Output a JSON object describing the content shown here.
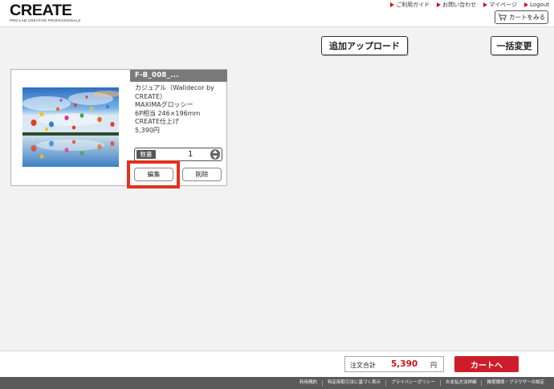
{
  "brand": {
    "logo_text": "CREATE",
    "tagline": "PRO-LAB CREATIVE PROFESSIONALS"
  },
  "top_links": [
    {
      "label": "ご利用ガイド"
    },
    {
      "label": "お問い合わせ"
    },
    {
      "label": "マイページ"
    },
    {
      "label": "Logout"
    }
  ],
  "header": {
    "cart_label": "カートをみる"
  },
  "toolbar": {
    "upload_label": "追加アップロード",
    "bulk_change_label": "一括変更"
  },
  "item": {
    "title": "F-B_008_...",
    "description_lines": [
      "カジュアル（Walldecor by",
      "CREATE）",
      "MAXIMAグロッシー",
      "6P相当 246×196mm",
      "CREATE仕上げ",
      "5,390円"
    ],
    "quantity_label": "数量",
    "quantity": "1",
    "edit_label": "編集",
    "delete_label": "削除"
  },
  "summary": {
    "total_label": "注文合計",
    "total_amount": "5,390",
    "currency": "円",
    "checkout_label": "カートへ"
  },
  "footer_links": [
    {
      "label": "利用規約"
    },
    {
      "label": "特定商取引法に基づく表示"
    },
    {
      "label": "プライバシーポリシー"
    },
    {
      "label": "お支払方法詳細"
    },
    {
      "label": "推奨環境・ブラウザーの設定"
    }
  ],
  "colors": {
    "accent_red": "#cc1e2a",
    "highlight": "#e0321f",
    "title_bar": "#7a7a7a"
  }
}
